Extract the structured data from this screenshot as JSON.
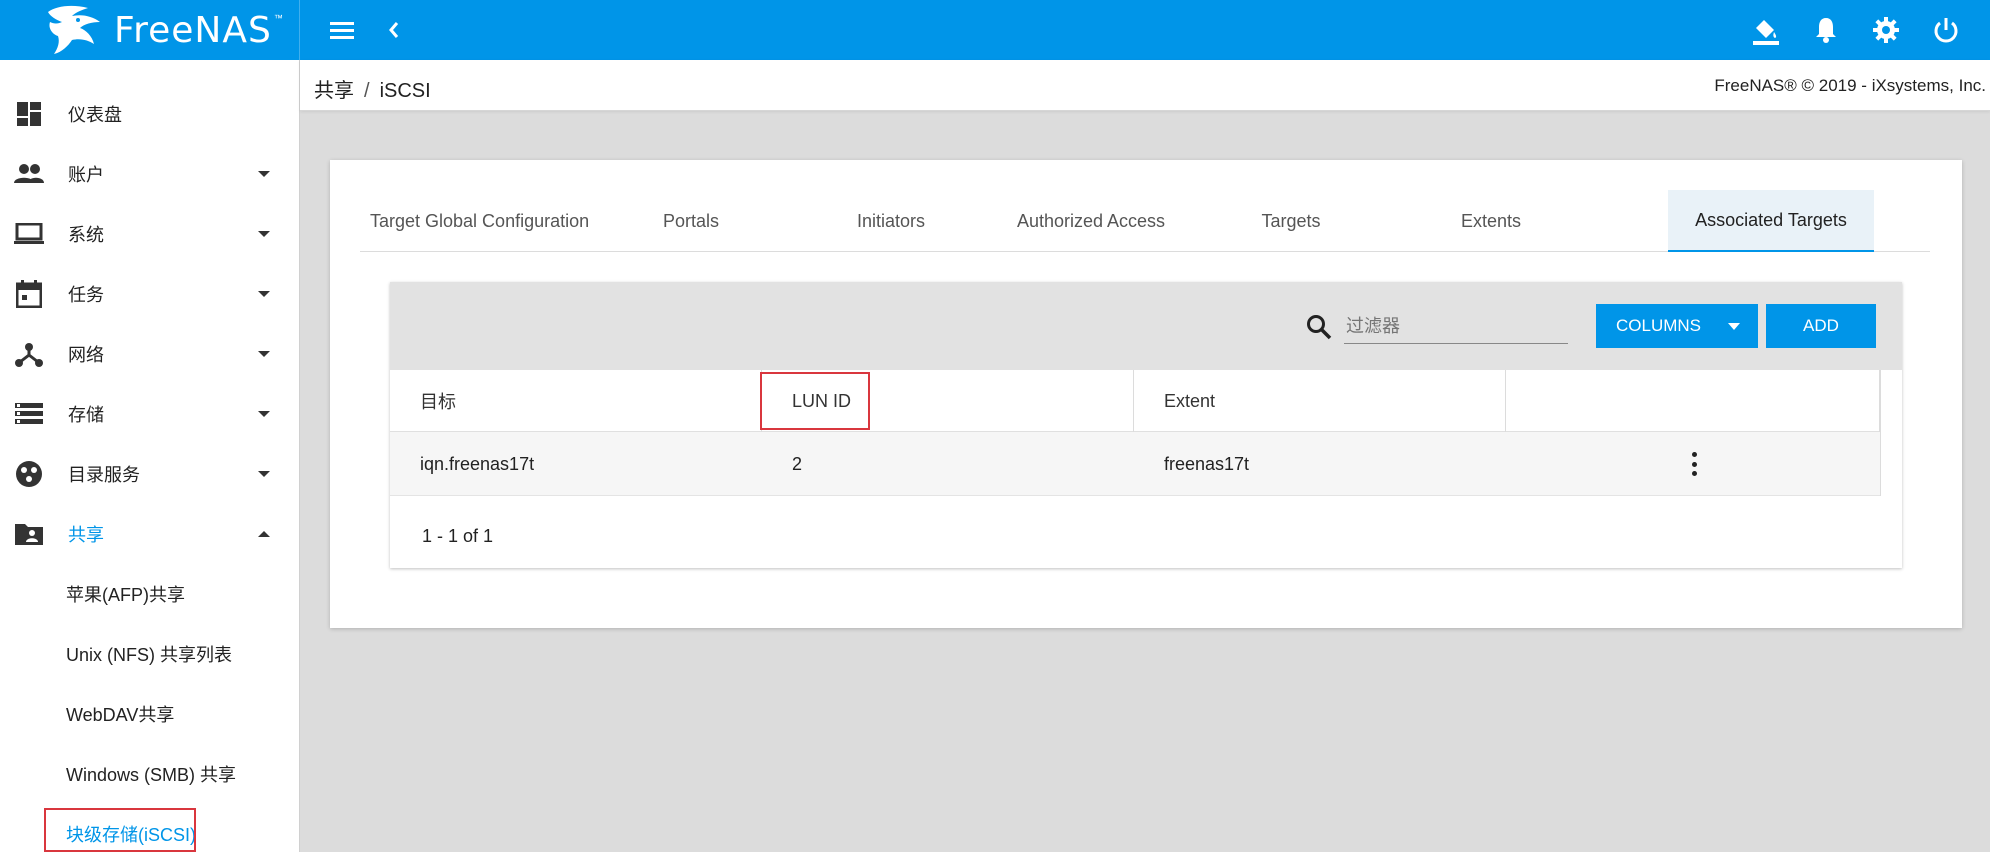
{
  "app": {
    "logo_text": "FreeNAS",
    "logo_tm": "™"
  },
  "topbar": {
    "icons": [
      "menu-icon",
      "chevron-left-icon",
      "paint-bucket-icon",
      "bell-icon",
      "gear-icon",
      "power-icon"
    ]
  },
  "sidebar": {
    "items": [
      {
        "label": "仪表盘",
        "icon": "dashboard-icon",
        "expandable": false
      },
      {
        "label": "账户",
        "icon": "people-icon",
        "expandable": true
      },
      {
        "label": "系统",
        "icon": "laptop-icon",
        "expandable": true
      },
      {
        "label": "任务",
        "icon": "calendar-icon",
        "expandable": true
      },
      {
        "label": "网络",
        "icon": "network-icon",
        "expandable": true
      },
      {
        "label": "存储",
        "icon": "storage-icon",
        "expandable": true
      },
      {
        "label": "目录服务",
        "icon": "directory-icon",
        "expandable": true
      },
      {
        "label": "共享",
        "icon": "shared-folder-icon",
        "expandable": true,
        "expanded": true
      }
    ],
    "sub_items": [
      {
        "label": "苹果(AFP)共享"
      },
      {
        "label": "Unix (NFS) 共享列表"
      },
      {
        "label": "WebDAV共享"
      },
      {
        "label": "Windows (SMB) 共享"
      },
      {
        "label": "块级存储(iSCSI)",
        "active": true
      }
    ]
  },
  "breadcrumb": {
    "parent": "共享",
    "separator": "/",
    "current": "iSCSI"
  },
  "copyright": "FreeNAS® © 2019 - iXsystems, Inc.",
  "tabs": [
    {
      "label": "Target Global Configuration"
    },
    {
      "label": "Portals"
    },
    {
      "label": "Initiators"
    },
    {
      "label": "Authorized Access"
    },
    {
      "label": "Targets"
    },
    {
      "label": "Extents"
    },
    {
      "label": "Associated Targets",
      "active": true
    }
  ],
  "toolbar": {
    "filter_placeholder": "过滤器",
    "columns_label": "COLUMNS",
    "add_label": "ADD"
  },
  "table": {
    "columns": [
      "目标",
      "LUN ID",
      "Extent",
      ""
    ],
    "rows": [
      {
        "target": "iqn.freenas17t",
        "lun_id": "2",
        "extent": "freenas17t"
      }
    ],
    "pager": "1 - 1 of 1"
  },
  "colors": {
    "primary": "#0095e8",
    "highlight": "#d9363e"
  }
}
